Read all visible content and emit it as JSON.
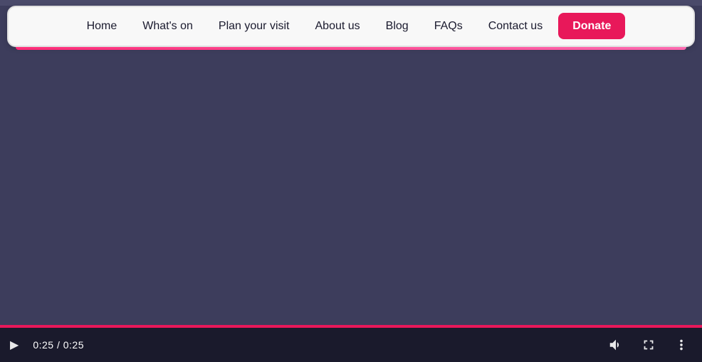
{
  "navbar": {
    "links": [
      {
        "id": "home",
        "label": "Home"
      },
      {
        "id": "whats-on",
        "label": "What's on"
      },
      {
        "id": "plan-your-visit",
        "label": "Plan your visit"
      },
      {
        "id": "about-us",
        "label": "About us"
      },
      {
        "id": "blog",
        "label": "Blog"
      },
      {
        "id": "faqs",
        "label": "FAQs"
      },
      {
        "id": "contact-us",
        "label": "Contact us"
      }
    ],
    "donate_label": "Donate"
  },
  "video": {
    "current_time": "0:25",
    "total_time": "0:25",
    "time_display": "0:25 / 0:25",
    "progress_percent": 100
  },
  "colors": {
    "accent": "#e8185a",
    "background": "#3d3d5c",
    "navbar_bg": "#f8f8f8"
  }
}
